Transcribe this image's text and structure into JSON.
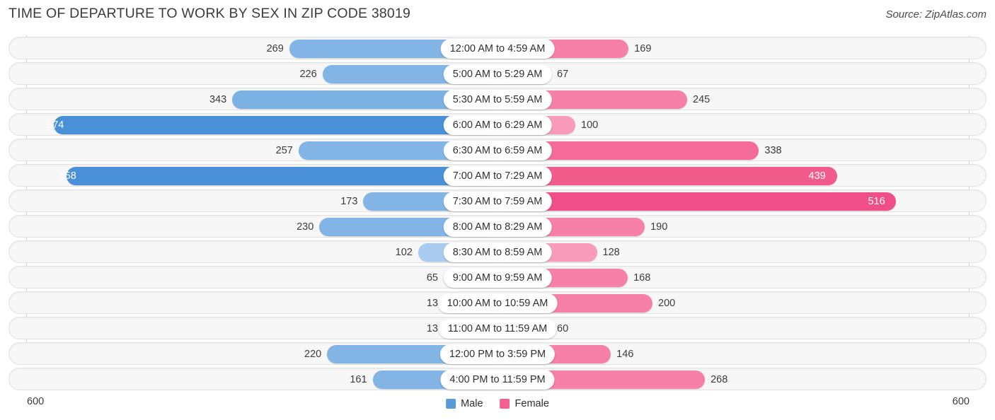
{
  "header": {
    "title": "TIME OF DEPARTURE TO WORK BY SEX IN ZIP CODE 38019",
    "source": "Source: ZipAtlas.com"
  },
  "axis": {
    "max_left": "600",
    "max_right": "600"
  },
  "legend": {
    "items": [
      {
        "label": "Male",
        "color": "#5b9bd5"
      },
      {
        "label": "Female",
        "color": "#f2618f"
      }
    ]
  },
  "chart_data": {
    "type": "bar",
    "title": "TIME OF DEPARTURE TO WORK BY SEX IN ZIP CODE 38019",
    "subtitle": "Source: ZipAtlas.com",
    "orientation": "horizontal-diverging",
    "xlabel": "",
    "ylabel": "",
    "xlim": [
      0,
      600
    ],
    "grid": false,
    "legend_position": "bottom-center",
    "categories": [
      "12:00 AM to 4:59 AM",
      "5:00 AM to 5:29 AM",
      "5:30 AM to 5:59 AM",
      "6:00 AM to 6:29 AM",
      "6:30 AM to 6:59 AM",
      "7:00 AM to 7:29 AM",
      "7:30 AM to 7:59 AM",
      "8:00 AM to 8:29 AM",
      "8:30 AM to 8:59 AM",
      "9:00 AM to 9:59 AM",
      "10:00 AM to 10:59 AM",
      "11:00 AM to 11:59 AM",
      "12:00 PM to 3:59 PM",
      "4:00 PM to 11:59 PM"
    ],
    "series": [
      {
        "name": "Male",
        "side": "left",
        "color": "#5b9bd5",
        "values": [
          269,
          226,
          343,
          574,
          257,
          558,
          173,
          230,
          102,
          65,
          13,
          13,
          220,
          161
        ]
      },
      {
        "name": "Female",
        "side": "right",
        "color": "#f2618f",
        "values": [
          169,
          67,
          245,
          100,
          338,
          439,
          516,
          190,
          128,
          168,
          200,
          60,
          146,
          268
        ]
      }
    ]
  },
  "rows": [
    {
      "label": "12:00 AM to 4:59 AM",
      "male": 269,
      "female": 169
    },
    {
      "label": "5:00 AM to 5:29 AM",
      "male": 226,
      "female": 67
    },
    {
      "label": "5:30 AM to 5:59 AM",
      "male": 343,
      "female": 245
    },
    {
      "label": "6:00 AM to 6:29 AM",
      "male": 574,
      "female": 100
    },
    {
      "label": "6:30 AM to 6:59 AM",
      "male": 257,
      "female": 338
    },
    {
      "label": "7:00 AM to 7:29 AM",
      "male": 558,
      "female": 439
    },
    {
      "label": "7:30 AM to 7:59 AM",
      "male": 173,
      "female": 516
    },
    {
      "label": "8:00 AM to 8:29 AM",
      "male": 230,
      "female": 190
    },
    {
      "label": "8:30 AM to 8:59 AM",
      "male": 102,
      "female": 128
    },
    {
      "label": "9:00 AM to 9:59 AM",
      "male": 65,
      "female": 168
    },
    {
      "label": "10:00 AM to 10:59 AM",
      "male": 13,
      "female": 200
    },
    {
      "label": "11:00 AM to 11:59 AM",
      "male": 13,
      "female": 60
    },
    {
      "label": "12:00 PM to 3:59 PM",
      "male": 220,
      "female": 146
    },
    {
      "label": "4:00 PM to 11:59 PM",
      "male": 161,
      "female": 268
    }
  ]
}
